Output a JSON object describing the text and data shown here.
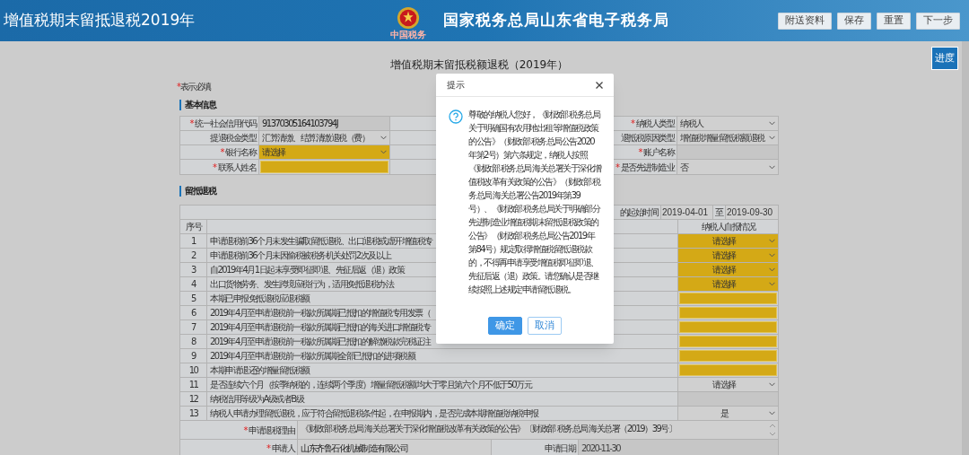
{
  "header": {
    "title": "增值税期末留抵退税2019年",
    "emblem_caption": "中国税务",
    "site_name": "国家税务总局山东省电子税务局",
    "buttons": [
      "附送资料",
      "保存",
      "重置",
      "下一步"
    ]
  },
  "progress_button": "进度",
  "page_title": "增值税期末留抵税额退税（2019年）",
  "required_note": {
    "asterisk": "*",
    "text": "表示必填"
  },
  "basic_info": {
    "title": "基本信息",
    "rows": [
      {
        "left": {
          "asterisk": "*",
          "label": "统一社会信用代码",
          "kind": "readonly",
          "value": "91370305164103794J",
          "highlighted": false
        },
        "right": {
          "asterisk": "*",
          "label": "纳税人类型",
          "kind": "select",
          "value": "纳税人",
          "highlighted": false
        }
      },
      {
        "left": {
          "label": "提退税金类型",
          "kind": "select",
          "value": "汇算清缴、结算清缴退税（费）",
          "highlighted": false
        },
        "right": {
          "label": "退抵税原因类型",
          "kind": "select",
          "value": "增值税增量留抵税额退税",
          "highlighted": false
        }
      },
      {
        "left": {
          "asterisk": "*",
          "label": "银行名称",
          "kind": "select",
          "value": "请选择",
          "highlighted": true
        },
        "right": {
          "asterisk": "*",
          "label": "账户名称",
          "kind": "disabled",
          "highlighted": false
        }
      },
      {
        "left": {
          "asterisk": "*",
          "label": "联系人姓名",
          "kind": "input",
          "highlighted": true
        },
        "right": {
          "asterisk": "*",
          "label": "是否先进制造业",
          "kind": "select",
          "value": "否",
          "highlighted": false
        }
      }
    ]
  },
  "refund": {
    "title": "留抵退税",
    "period": {
      "label": "的起始时间",
      "start": "2019-04-01",
      "separator": "至",
      "end": "2019-09-30"
    },
    "columns": [
      "序号",
      "纳税人自报情况"
    ],
    "rows": [
      {
        "no": "1",
        "text": "申请退税前36个月未发生骗取留抵退税、出口退税或虚开增值税专",
        "answer": {
          "kind": "select",
          "value": "请选择",
          "highlighted": true
        }
      },
      {
        "no": "2",
        "text": "申请退税前36个月未因偷税被税务机关处罚2次及以上",
        "answer": {
          "kind": "select",
          "value": "请选择",
          "highlighted": true
        }
      },
      {
        "no": "3",
        "text": "自2019年4月1日起未享受即征即退、先征后返（退）政策",
        "answer": {
          "kind": "select",
          "value": "请选择",
          "highlighted": true
        }
      },
      {
        "no": "4",
        "text": "出口货物劳务、发生跨境应税行为，适用免抵退税办法",
        "answer": {
          "kind": "select",
          "value": "请选择",
          "highlighted": true
        }
      },
      {
        "no": "5",
        "text": "本期已申报免抵退税应退税额",
        "answer": {
          "kind": "input",
          "highlighted": true
        }
      },
      {
        "no": "6",
        "text": "2019年4月至申请退税前一税款所属期已抵扣的增值税专用发票（",
        "answer": {
          "kind": "input",
          "highlighted": true
        }
      },
      {
        "no": "7",
        "text": "2019年4月至申请退税前一税款所属期已抵扣的海关进口增值税专",
        "answer": {
          "kind": "input",
          "highlighted": true
        }
      },
      {
        "no": "8",
        "text": "2019年4月至申请退税前一税款所属期已抵扣的解缴税款完税证注",
        "answer": {
          "kind": "input",
          "highlighted": true
        }
      },
      {
        "no": "9",
        "text": "2019年4月至申请退税前一税款所属期全部已抵扣的进项税额",
        "answer": {
          "kind": "input",
          "highlighted": true
        }
      },
      {
        "no": "10",
        "text": "本期申请退还的增量留抵税额",
        "answer": {
          "kind": "input",
          "highlighted": true
        }
      },
      {
        "no": "11",
        "text": "是否连续六个月（按季纳税的，连续两个季度）增量留抵税额均大于零且第六个月不低于50万元",
        "answer": {
          "kind": "select",
          "value": "请选择",
          "highlighted": false
        }
      },
      {
        "no": "12",
        "text": "纳税信用等级为A级或者B级",
        "answer": {
          "kind": "disabled",
          "highlighted": false
        }
      },
      {
        "no": "13",
        "text": "纳税人申请办理留抵退税，应于符合留抵退税条件起，在申报期内，是否完成本期增值税纳税申报",
        "answer": {
          "kind": "select",
          "value": "是",
          "highlighted": false
        }
      }
    ],
    "reason": {
      "asterisk": "*",
      "label": "申请退税理由",
      "value": "《财政部 税务总局 海关总署关于深化增值税改革有关政策的公告》〔财政部 税务总局 海关总署（2019）39号〕"
    },
    "applicant": {
      "asterisk": "*",
      "label": "申请人",
      "value": "山东齐鲁石化机械制造有限公司"
    },
    "date": {
      "label": "申请日期",
      "value": "2020-11-30"
    }
  },
  "dialog": {
    "title": "提示",
    "message": "尊敬的纳税人您好，《财政部 税务总局关于明确国有农用地出租等增值税政策的公告》（财政部 税务总局公告2020年第2号）第六条规定，纳税人按照《财政部 税务总局 海关总署关于深化增值税改革有关政策的公告》（财政部 税务总局 海关总署公告2019年第39号）、《财政部 税务总局关于明确部分先进制造业增值税期末留抵退税政策的公告》（财政部 税务总局公告2019年第84号）规定取得增值税留抵退税款的，不得再申请享受增值税即征即退、先征后返（退）政策。请您确认是否继续按照上述规定申请留抵退税。",
    "buttons": [
      {
        "label": "确定",
        "kind": "primary"
      },
      {
        "label": "取消",
        "kind": "secondary"
      }
    ]
  }
}
